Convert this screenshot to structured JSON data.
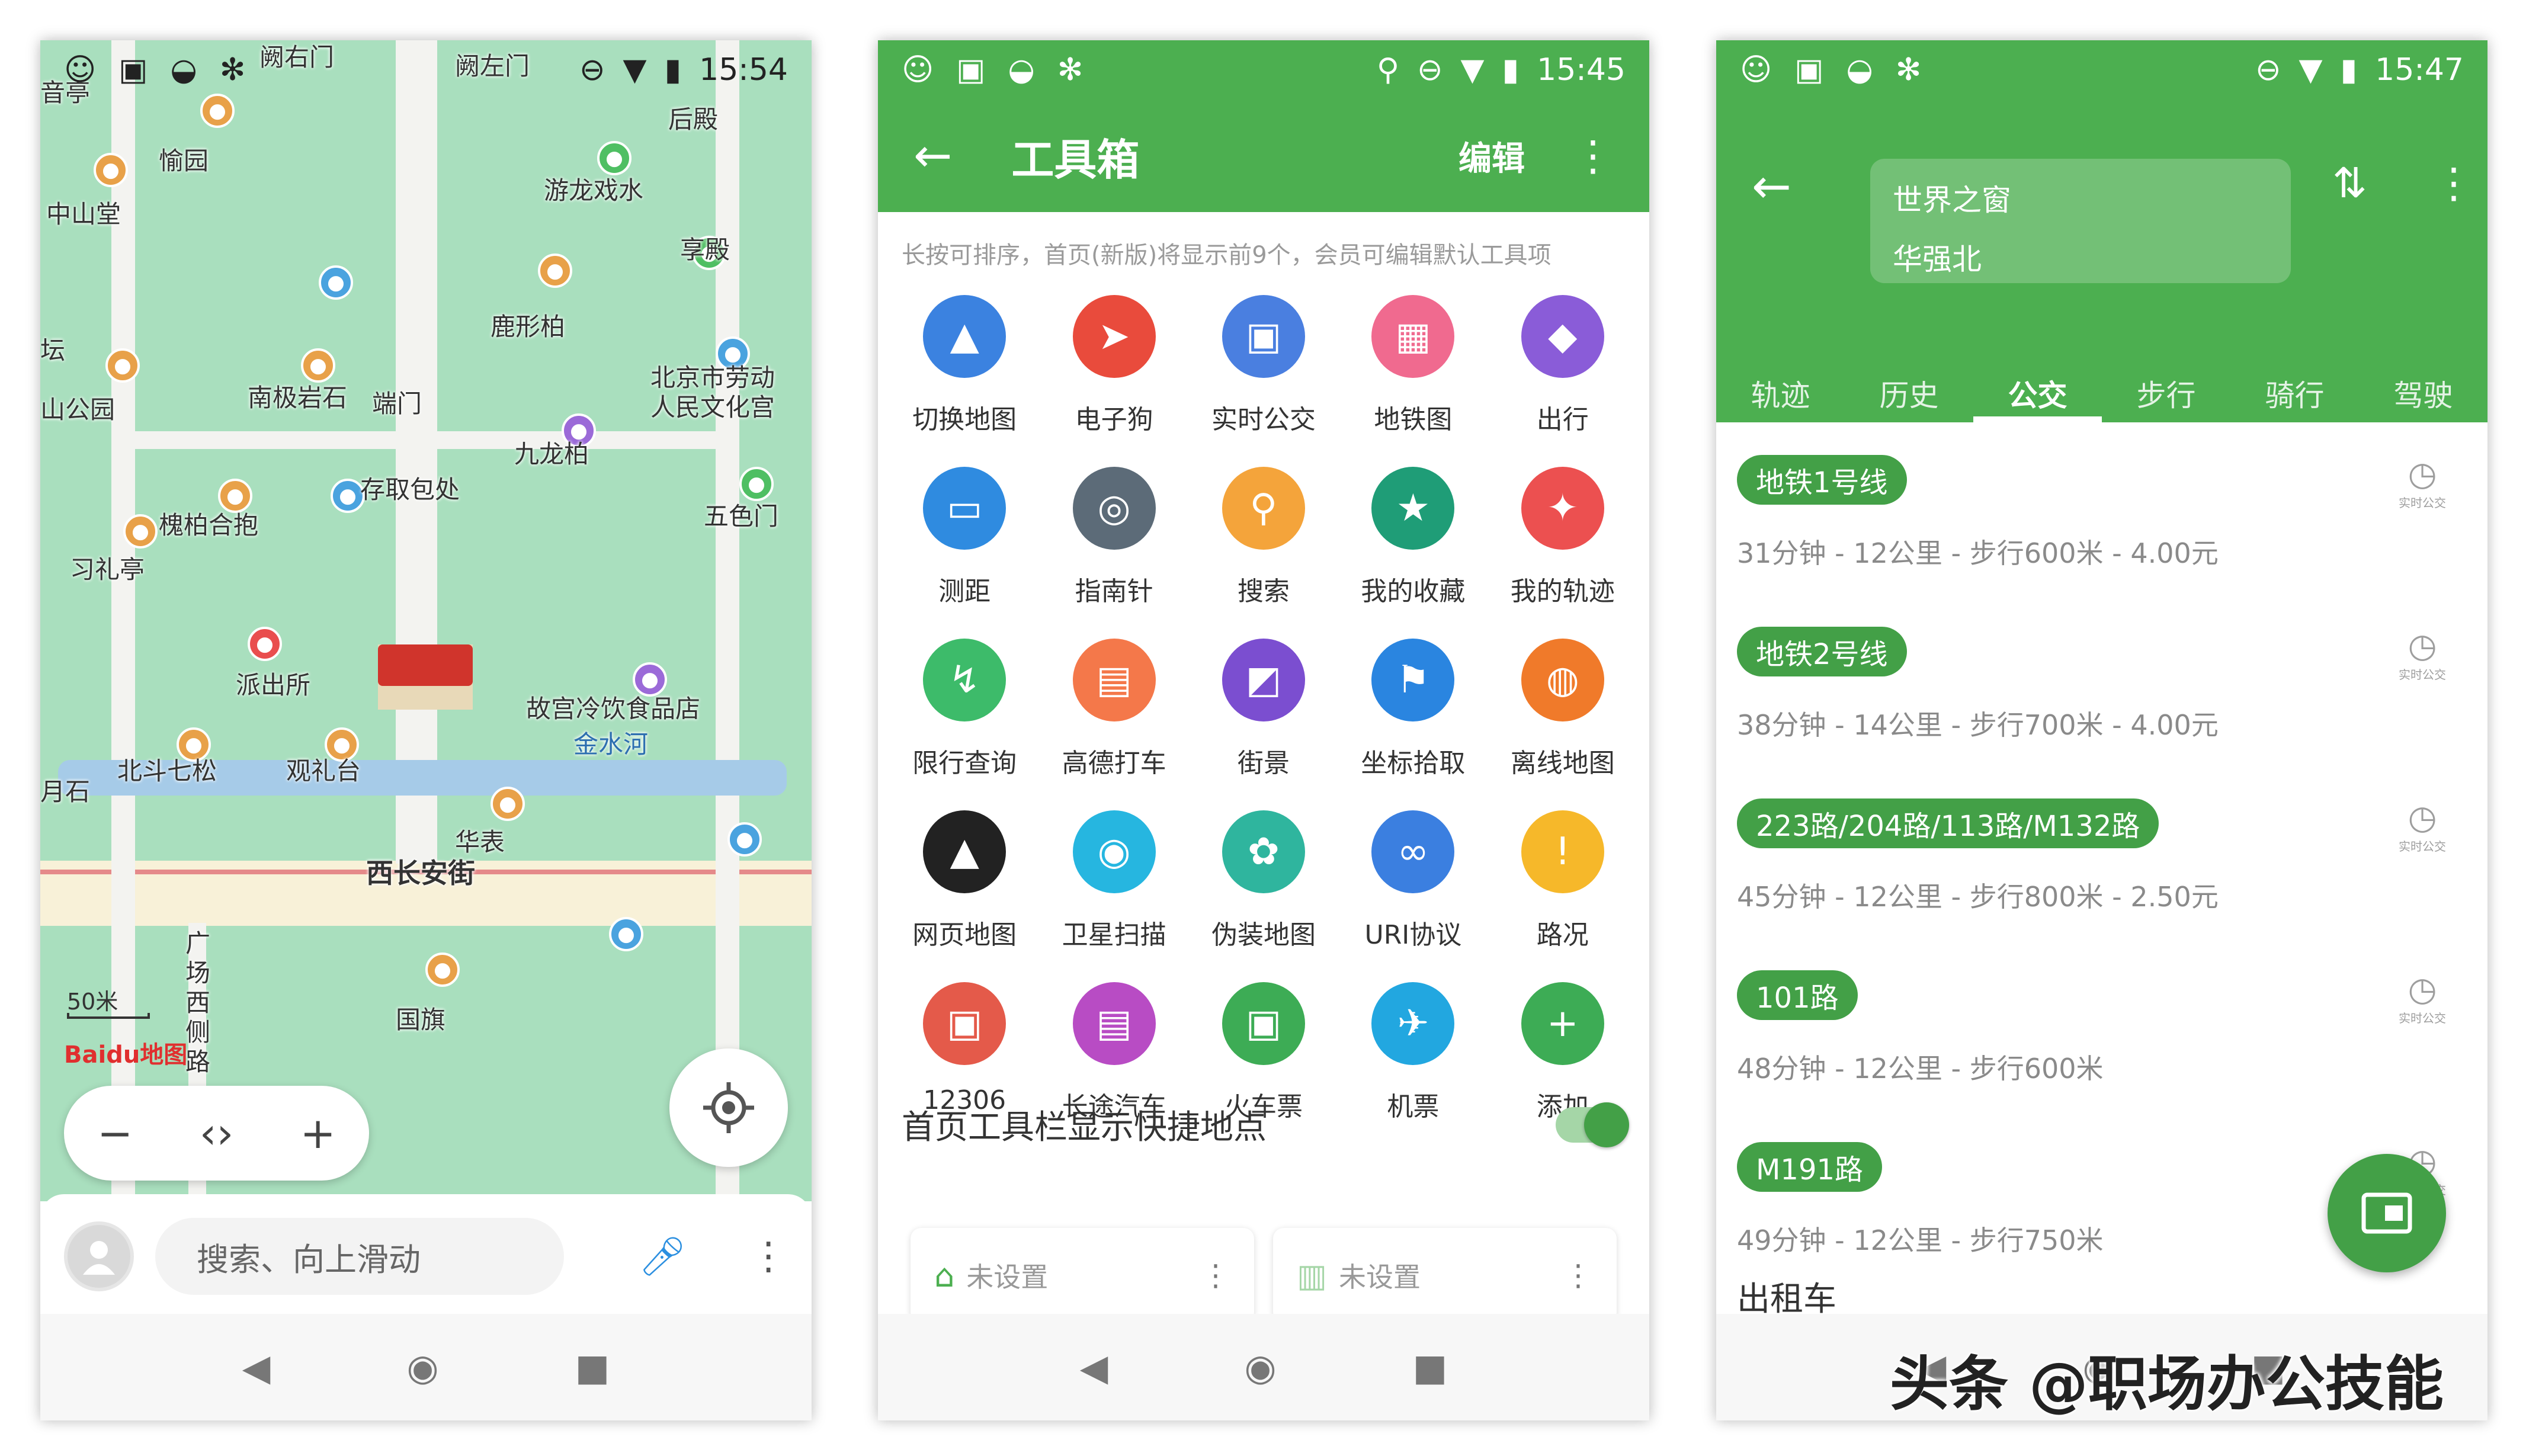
{
  "phone1": {
    "status_time": "15:54",
    "map_labels": {
      "a": "阙右门",
      "b": "阙左门",
      "c": "后殿",
      "d": "愉园",
      "e": "中山堂",
      "f": "游龙戏水",
      "g": "享殿",
      "h": "鹿形柏",
      "i": "南极岩石",
      "j": "端门",
      "k": "北京市劳动人民文化宫",
      "l": "九龙柏",
      "m": "存取包处",
      "n": "五色门",
      "o": "槐柏合抱",
      "p": "习礼亭",
      "q": "派出所",
      "r": "故宫冷饮食品店",
      "s": "金水河",
      "t": "北斗七松",
      "u": "观礼台",
      "v": "华表",
      "w": "西长安街",
      "x": "广场西侧路",
      "y": "国旗",
      "z": "山公园",
      "aa": "坛",
      "ab": "月石",
      "ac": "音亭"
    },
    "scale": "50米",
    "logo": "Baidu地图",
    "search_placeholder": "搜索、向上滑动"
  },
  "phone2": {
    "status_time": "15:45",
    "title": "工具箱",
    "edit": "编辑",
    "hint": "长按可排序，首页(新版)将显示前9个，会员可编辑默认工具项",
    "tools": [
      {
        "label": "切换地图",
        "color": "#3b82e0",
        "glyph": "▲"
      },
      {
        "label": "电子狗",
        "color": "#e94b3c",
        "glyph": "➤"
      },
      {
        "label": "实时公交",
        "color": "#4a7fe0",
        "glyph": "▣"
      },
      {
        "label": "地铁图",
        "color": "#f06a8f",
        "glyph": "▦"
      },
      {
        "label": "出行",
        "color": "#8a5cd8",
        "glyph": "◆"
      },
      {
        "label": "测距",
        "color": "#2f8be0",
        "glyph": "▭"
      },
      {
        "label": "指南针",
        "color": "#5c6b78",
        "glyph": "◎"
      },
      {
        "label": "搜索",
        "color": "#f4a43b",
        "glyph": "⚲"
      },
      {
        "label": "我的收藏",
        "color": "#1f9d77",
        "glyph": "★"
      },
      {
        "label": "我的轨迹",
        "color": "#ec5050",
        "glyph": "✦"
      },
      {
        "label": "限行查询",
        "color": "#3dbb6a",
        "glyph": "↯"
      },
      {
        "label": "高德打车",
        "color": "#f4784a",
        "glyph": "▤"
      },
      {
        "label": "街景",
        "color": "#7b4ed0",
        "glyph": "◩"
      },
      {
        "label": "坐标拾取",
        "color": "#2a85e0",
        "glyph": "⚑"
      },
      {
        "label": "离线地图",
        "color": "#f07a2a",
        "glyph": "◍"
      },
      {
        "label": "网页地图",
        "color": "#222222",
        "glyph": "▲"
      },
      {
        "label": "卫星扫描",
        "color": "#26b6e0",
        "glyph": "◉"
      },
      {
        "label": "伪装地图",
        "color": "#2fb59e",
        "glyph": "✿"
      },
      {
        "label": "URI协议",
        "color": "#3b7fe0",
        "glyph": "∞"
      },
      {
        "label": "路况",
        "color": "#f6b82a",
        "glyph": "!"
      },
      {
        "label": "12306",
        "color": "#e45a4a",
        "glyph": "▣"
      },
      {
        "label": "长途汽车",
        "color": "#b84cc4",
        "glyph": "▤"
      },
      {
        "label": "火车票",
        "color": "#3dac55",
        "glyph": "▣"
      },
      {
        "label": "机票",
        "color": "#22a7e0",
        "glyph": "✈"
      },
      {
        "label": "添加",
        "color": "#3dac55",
        "glyph": "+"
      }
    ],
    "toggle_label": "首页工具栏显示快捷地点",
    "quick_home": "未设置",
    "quick_work": "未设置"
  },
  "phone3": {
    "status_time": "15:47",
    "from": "世界之窗",
    "to": "华强北",
    "tabs": [
      "轨迹",
      "历史",
      "公交",
      "步行",
      "骑行",
      "驾驶"
    ],
    "realtime_label": "实时公交",
    "routes": [
      {
        "name": "地铁1号线",
        "meta": "31分钟 - 12公里 - 步行600米 - 4.00元"
      },
      {
        "name": "地铁2号线",
        "meta": "38分钟 - 14公里 - 步行700米 - 4.00元"
      },
      {
        "name": "223路/204路/113路/M132路",
        "meta": "45分钟 - 12公里 - 步行800米 - 2.50元"
      },
      {
        "name": "101路",
        "meta": "48分钟 - 12公里 - 步行600米"
      },
      {
        "name": "M191路",
        "meta": "49分钟 - 12公里 - 步行750米"
      }
    ],
    "taxi": "出租车"
  },
  "watermark": "头条 @职场办公技能"
}
